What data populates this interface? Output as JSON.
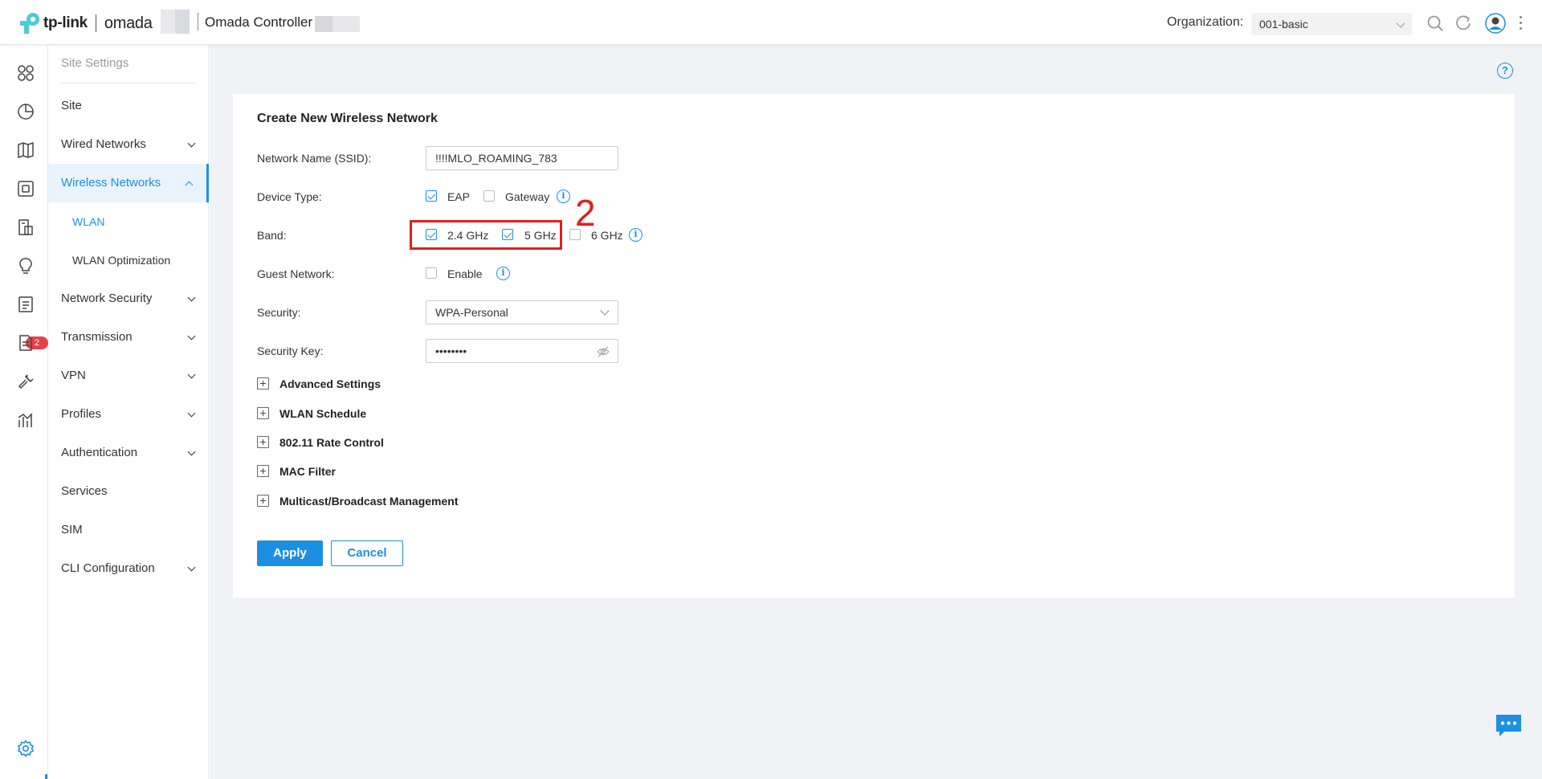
{
  "header": {
    "brand": "tp-link",
    "product": "omada",
    "app_title": "Omada Controller",
    "org_label": "Organization:",
    "org_value": "001-basic"
  },
  "rail": {
    "badge_count": "2",
    "icons": [
      "dashboard-icon",
      "statistics-icon",
      "map-icon",
      "devices-icon",
      "clients-icon",
      "insight-icon",
      "logs-icon",
      "reports-icon",
      "tools-icon",
      "analytics-icon",
      "settings-icon"
    ]
  },
  "sidebar": {
    "title": "Site Settings",
    "items": [
      {
        "label": "Site"
      },
      {
        "label": "Wired Networks"
      },
      {
        "label": "Wireless Networks"
      },
      {
        "label": "WLAN"
      },
      {
        "label": "WLAN Optimization"
      },
      {
        "label": "Network Security"
      },
      {
        "label": "Transmission"
      },
      {
        "label": "VPN"
      },
      {
        "label": "Profiles"
      },
      {
        "label": "Authentication"
      },
      {
        "label": "Services"
      },
      {
        "label": "SIM"
      },
      {
        "label": "CLI Configuration"
      }
    ]
  },
  "form": {
    "title": "Create New Wireless Network",
    "ssid_label": "Network Name (SSID):",
    "ssid_value": "!!!!MLO_ROAMING_783",
    "device_type_label": "Device Type:",
    "device_eap": "EAP",
    "device_gateway": "Gateway",
    "band_label": "Band:",
    "band_24": "2.4 GHz",
    "band_5": "5 GHz",
    "band_6": "6 GHz",
    "guest_label": "Guest Network:",
    "guest_enable": "Enable",
    "security_label": "Security:",
    "security_value": "WPA-Personal",
    "key_label": "Security Key:",
    "key_value": "••••••••",
    "sections": [
      "Advanced Settings",
      "WLAN Schedule",
      "802.11 Rate Control",
      "MAC Filter",
      "Multicast/Broadcast Management"
    ],
    "apply": "Apply",
    "cancel": "Cancel"
  },
  "annotation": {
    "number": "2"
  },
  "colors": {
    "accent": "#1d8fe3",
    "highlight": "#e0201c",
    "background": "#f0f2f5"
  }
}
